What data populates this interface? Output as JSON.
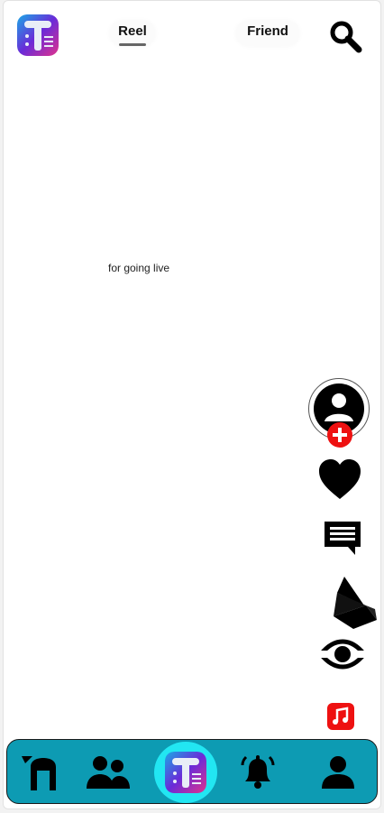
{
  "header": {
    "tabs": [
      {
        "label": "Reel",
        "active": true
      },
      {
        "label": "Friend",
        "active": false
      }
    ],
    "icons": {
      "logo": "app-logo",
      "search": "search-icon"
    }
  },
  "video": {
    "overlay_text": "for going live"
  },
  "actions": {
    "icons": [
      "avatar-icon",
      "follow-plus-icon",
      "heart-icon",
      "comment-icon",
      "share-icon",
      "view-icon",
      "music-icon"
    ],
    "colors": {
      "plus": "#ee1111",
      "music": "#ee1111"
    }
  },
  "bottom_nav": {
    "items": [
      "home-icon",
      "friends-icon",
      "create-logo",
      "notifications-bell-icon",
      "profile-icon"
    ],
    "colors": {
      "bar": "#0d9bb3",
      "center_ring": "#22e6f2"
    }
  }
}
